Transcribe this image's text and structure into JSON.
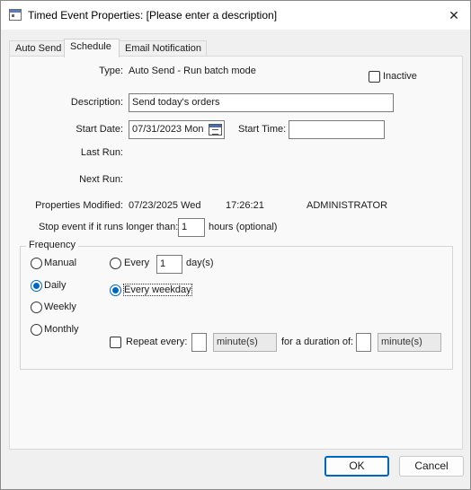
{
  "window": {
    "title": "Timed Event Properties: [Please enter a description]"
  },
  "tabs": [
    {
      "label": "Auto Send",
      "active": false
    },
    {
      "label": "Schedule",
      "active": true
    },
    {
      "label": "Email Notification",
      "active": false
    }
  ],
  "schedule": {
    "type_label": "Type:",
    "type_value": "Auto Send - Run batch mode",
    "inactive_label": "Inactive",
    "inactive_checked": false,
    "description_label": "Description:",
    "description_value": "Send today's orders",
    "start_date_label": "Start Date:",
    "start_date_value": "07/31/2023 Mon",
    "start_time_label": "Start Time:",
    "start_time_value": "",
    "last_run_label": "Last Run:",
    "next_run_label": "Next Run:",
    "properties_modified_label": "Properties Modified:",
    "properties_modified_date": "07/23/2025 Wed",
    "properties_modified_time": "17:26:21",
    "properties_modified_user": "ADMINISTRATOR",
    "stop_event_label": "Stop event if it runs longer than:",
    "stop_event_value": "1",
    "hours_label": "hours (optional)"
  },
  "frequency": {
    "legend": "Frequency",
    "manual_label": "Manual",
    "daily_label": "Daily",
    "weekly_label": "Weekly",
    "monthly_label": "Monthly",
    "selected": "Daily",
    "every_label": "Every",
    "every_value": "1",
    "days_label": "day(s)",
    "every_weekday_label": "Every weekday",
    "daily_option_selected": "Every weekday",
    "repeat_label": "Repeat every:",
    "repeat_checked": false,
    "repeat_value": "",
    "repeat_unit": "minute(s)",
    "duration_label": "for a duration of:",
    "duration_value": "",
    "duration_unit": "minute(s)"
  },
  "buttons": {
    "ok": "OK",
    "cancel": "Cancel"
  },
  "colors": {
    "accent": "#0067c0",
    "window_bg": "#f0f0f0",
    "panel_bg": "#f9f9f9"
  }
}
